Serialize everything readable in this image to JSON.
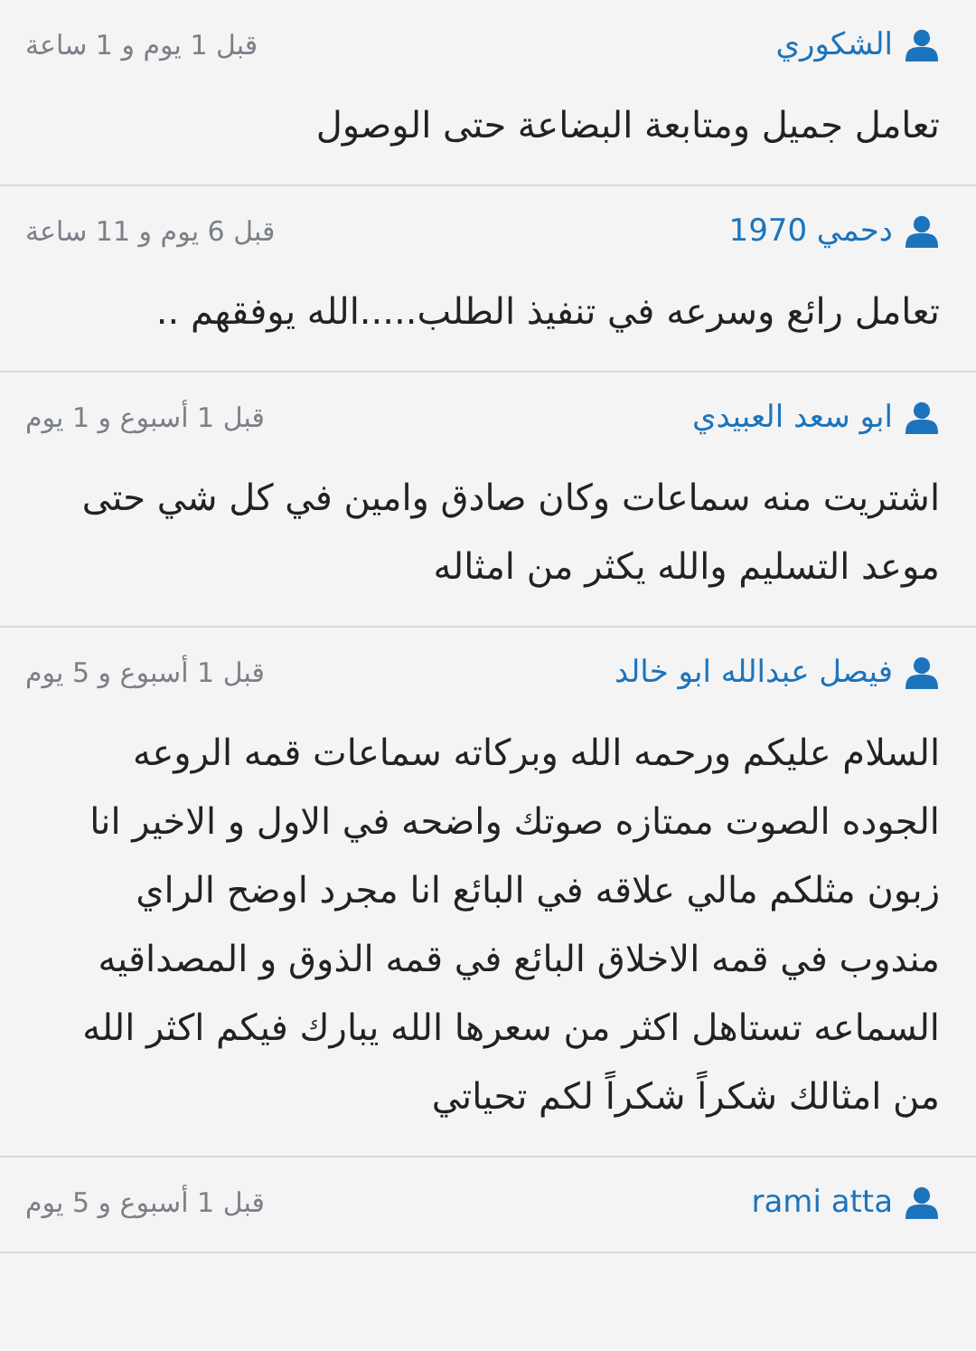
{
  "reviews": [
    {
      "author": "الشكوري",
      "time": "قبل 1 يوم و 1 ساعة",
      "text": "تعامل جميل ومتابعة البضاعة حتى الوصول"
    },
    {
      "author": "دحمي 1970",
      "time": "قبل 6 يوم و 11 ساعة",
      "text": "تعامل رائع وسرعه في تنفيذ الطلب.....الله يوفقهم .."
    },
    {
      "author": "ابو سعد العبيدي",
      "time": "قبل 1 أسبوع و 1 يوم",
      "text": "اشتريت منه سماعات وكان صادق وامين في كل شي حتى موعد التسليم والله يكثر من امثاله"
    },
    {
      "author": "فيصل عبدالله ابو خالد",
      "time": "قبل 1 أسبوع و 5 يوم",
      "text": "السلام عليكم ورحمه الله وبركاته  سماعات قمه الروعه الجوده الصوت ممتازه صوتك واضحه في الاول و الاخير انا زبون مثلكم مالي علاقه في البائع انا مجرد اوضح الراي مندوب في قمه الاخلاق البائع في قمه الذوق و المصداقيه السماعه تستاهل اكثر من سعرها الله يبارك فيكم اكثر الله من امثالك شكراً شكراً لكم تحياتي"
    },
    {
      "author": "rami atta",
      "time": "قبل 1 أسبوع و 5 يوم"
    }
  ]
}
